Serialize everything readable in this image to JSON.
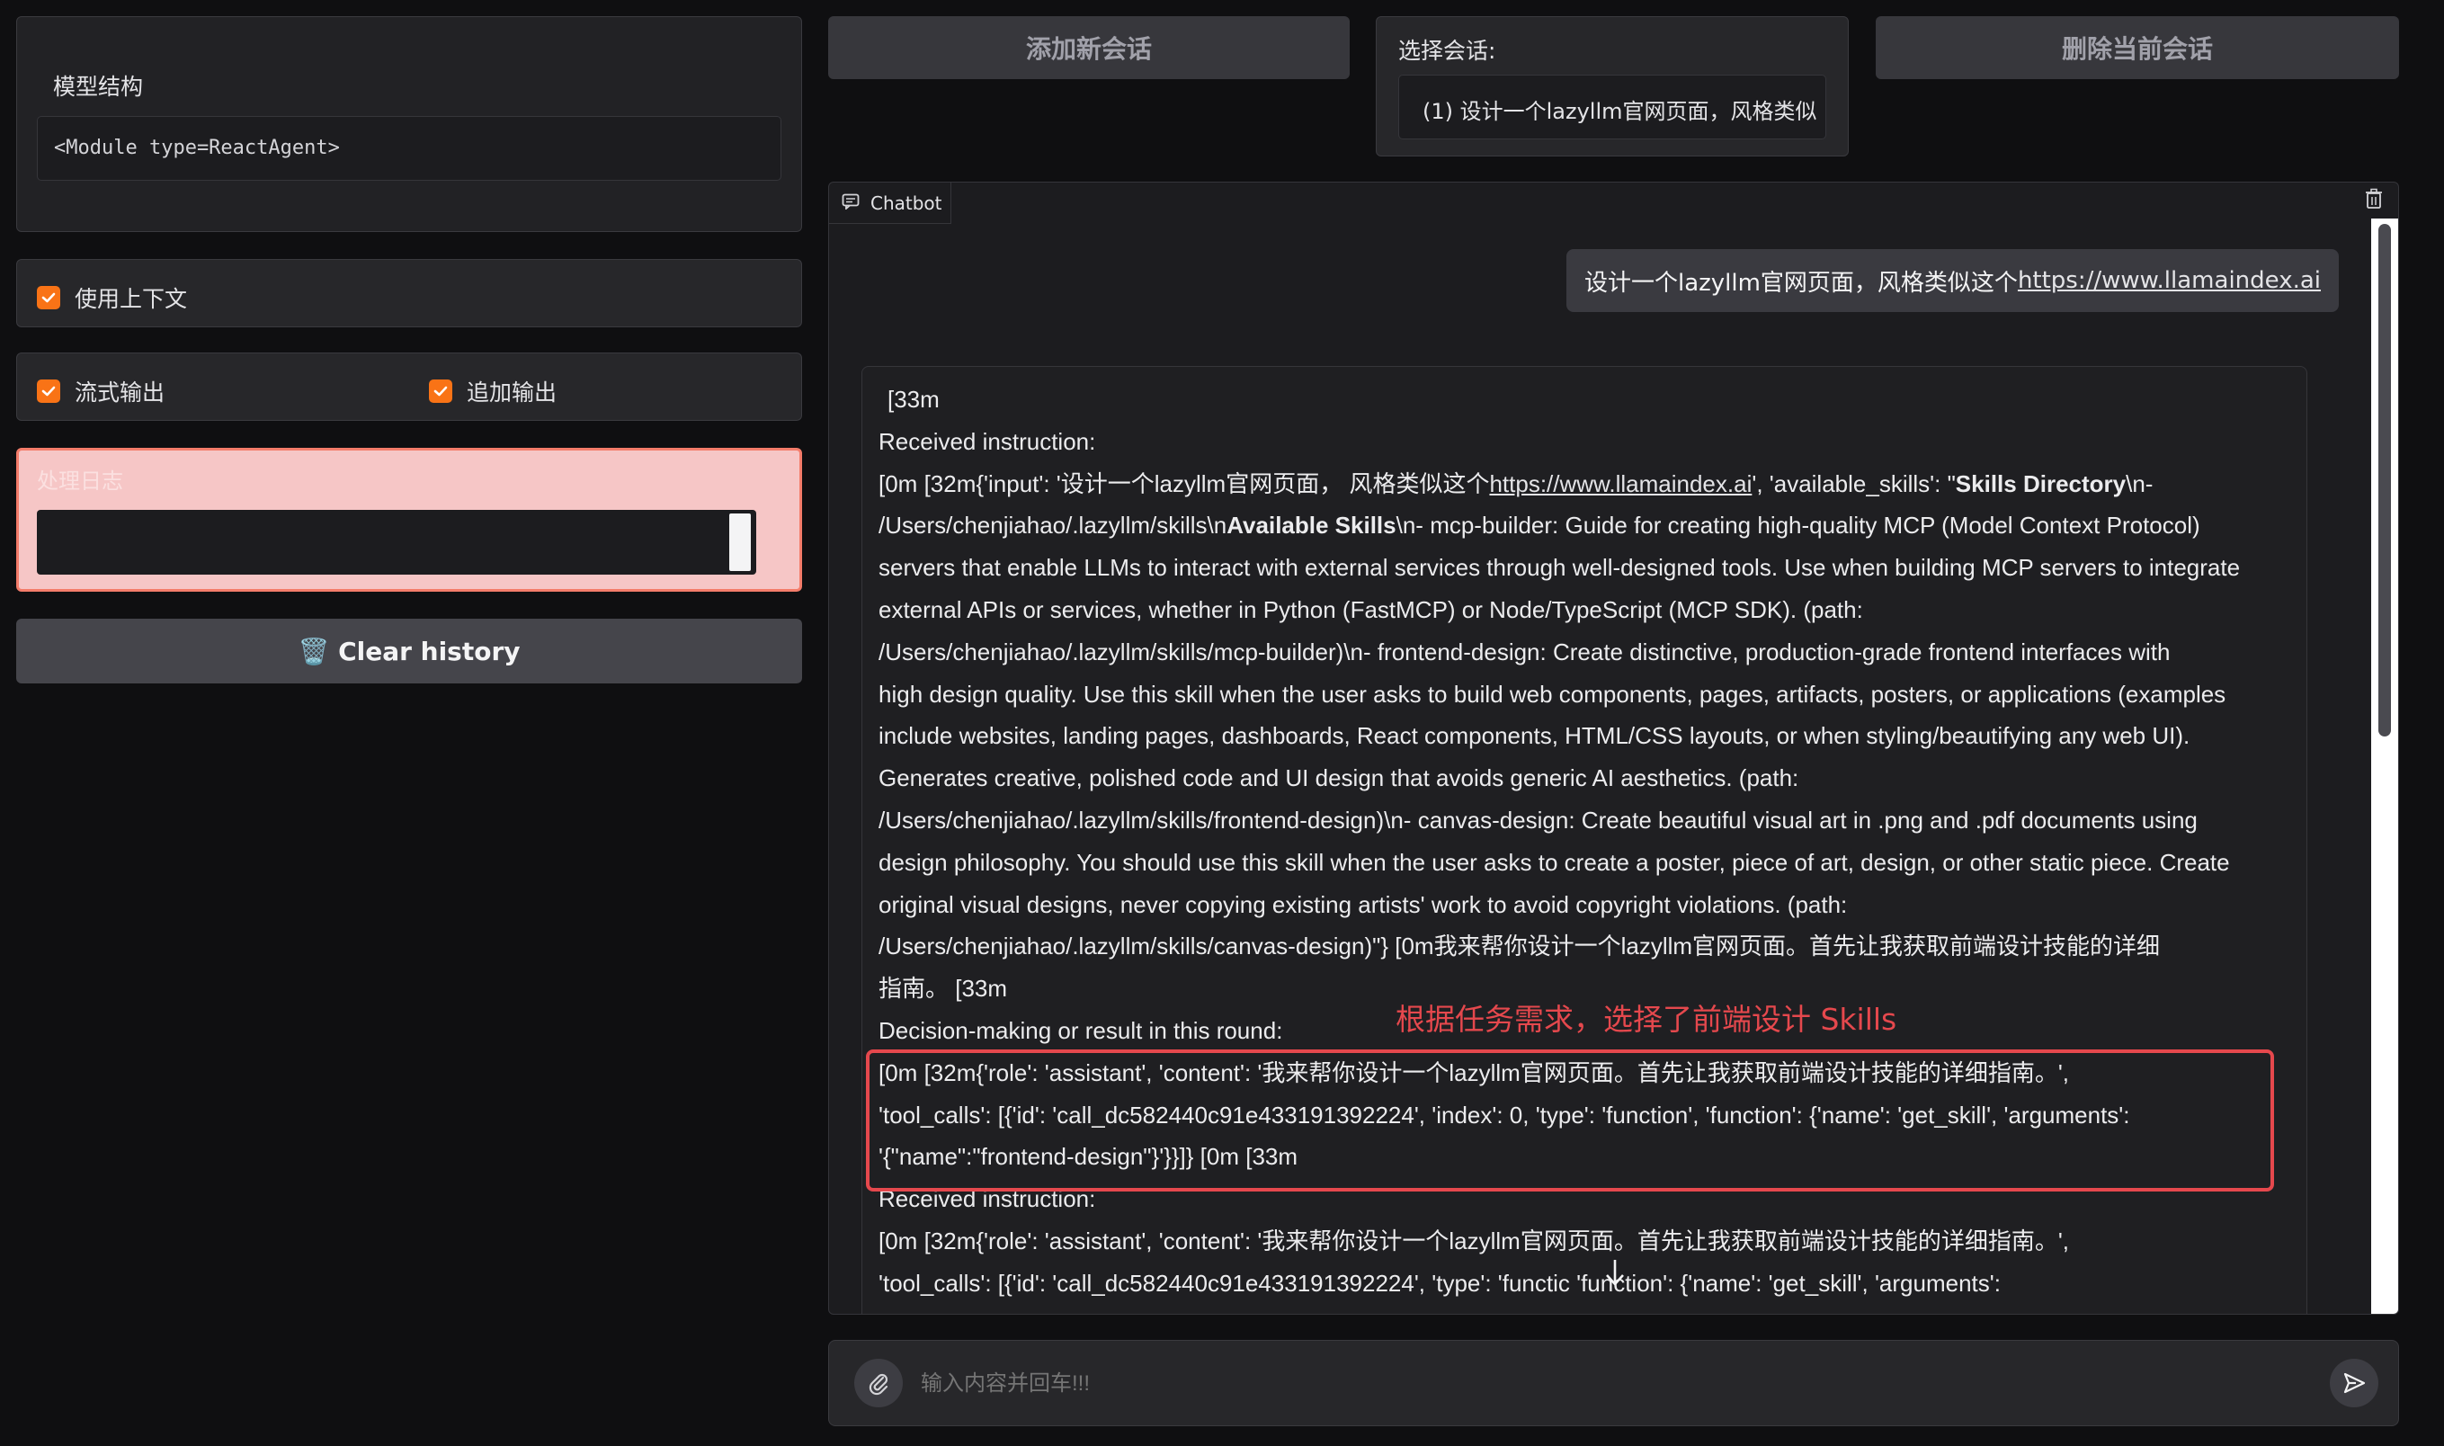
{
  "left": {
    "model_structure_label": "模型结构",
    "model_structure_value": "<Module type=ReactAgent>",
    "use_context_label": "使用上下文",
    "stream_output_label": "流式输出",
    "append_output_label": "追加输出",
    "log_label": "处理日志",
    "clear_history_label": "🗑️ Clear history"
  },
  "top": {
    "add_session_label": "添加新会话",
    "select_session_label": "选择会话:",
    "select_session_value": "(1) 设计一个lazyllm官网页面，风格类似",
    "delete_session_label": "删除当前会话"
  },
  "chatbot": {
    "tab_label": "Chatbot",
    "user_message_prefix": "设计一个lazyllm官网页面，风格类似这个",
    "user_message_link": "https://www.llamaindex.ai",
    "bot": {
      "l1": "[33m",
      "l2": "Received instruction:",
      "l3a": " [0m [32m{'input': '设计一个lazyllm官网页面， 风格类似这个",
      "l3link": "https://www.llamaindex.ai",
      "l3b": "', 'available_skills': \"",
      "l3bold": "Skills Directory",
      "l3c": "\\n-",
      "l4a": "/Users/chenjiahao/.lazyllm/skills\\n",
      "l4bold": "Available Skills",
      "l4b": "\\n- mcp-builder: Guide for creating high-quality MCP (Model Context Protocol)",
      "l5": "servers that enable LLMs to interact with external services through well-designed tools. Use when building MCP servers to integrate",
      "l6": "external APIs or services, whether in Python (FastMCP) or Node/TypeScript (MCP SDK). (path:",
      "l7": "/Users/chenjiahao/.lazyllm/skills/mcp-builder)\\n- frontend-design: Create distinctive, production-grade frontend interfaces with",
      "l8": "high design quality. Use this skill when the user asks to build web components, pages, artifacts, posters, or applications (examples",
      "l9": "include websites, landing pages, dashboards, React components, HTML/CSS layouts, or when styling/beautifying any web UI).",
      "l10": "Generates creative, polished code and UI design that avoids generic AI aesthetics. (path:",
      "l11": "/Users/chenjiahao/.lazyllm/skills/frontend-design)\\n- canvas-design: Create beautiful visual art in .png and .pdf documents using",
      "l12": "design philosophy. You should use this skill when the user asks to create a poster, piece of art, design, or other static piece. Create",
      "l13": "original visual designs, never copying existing artists' work to avoid copyright violations. (path:",
      "l14": "/Users/chenjiahao/.lazyllm/skills/canvas-design)\"} [0m我来帮你设计一个lazyllm官网页面。首先让我获取前端设计技能的详细",
      "l15": "指南。 [33m",
      "l16": "Decision-making or result in this round:",
      "annotation": "根据任务需求，选择了前端设计 Skills",
      "h1": " [0m [32m{'role': 'assistant', 'content': '我来帮你设计一个lazyllm官网页面。首先让我获取前端设计技能的详细指南。',",
      "h2": "'tool_calls': [{'id': 'call_dc582440c91e433191392224', 'index': 0, 'type': 'function', 'function': {'name': 'get_skill', 'arguments':",
      "h3": "'{\"name\":\"frontend-design\"}'}}]} [0m [33m",
      "l17": "Received instruction:",
      "l18": " [0m [32m{'role': 'assistant', 'content': '我来帮你设计一个lazyllm官网页面。首先让我获取前端设计技能的详细指南。',",
      "l19": "'tool_calls': [{'id': 'call_dc582440c91e433191392224', 'type': 'functic   'function': {'name': 'get_skill', 'arguments':"
    }
  },
  "input": {
    "placeholder": "输入内容并回车!!!"
  },
  "colors": {
    "accent": "#f97316",
    "annotation_red": "#e5484d"
  }
}
